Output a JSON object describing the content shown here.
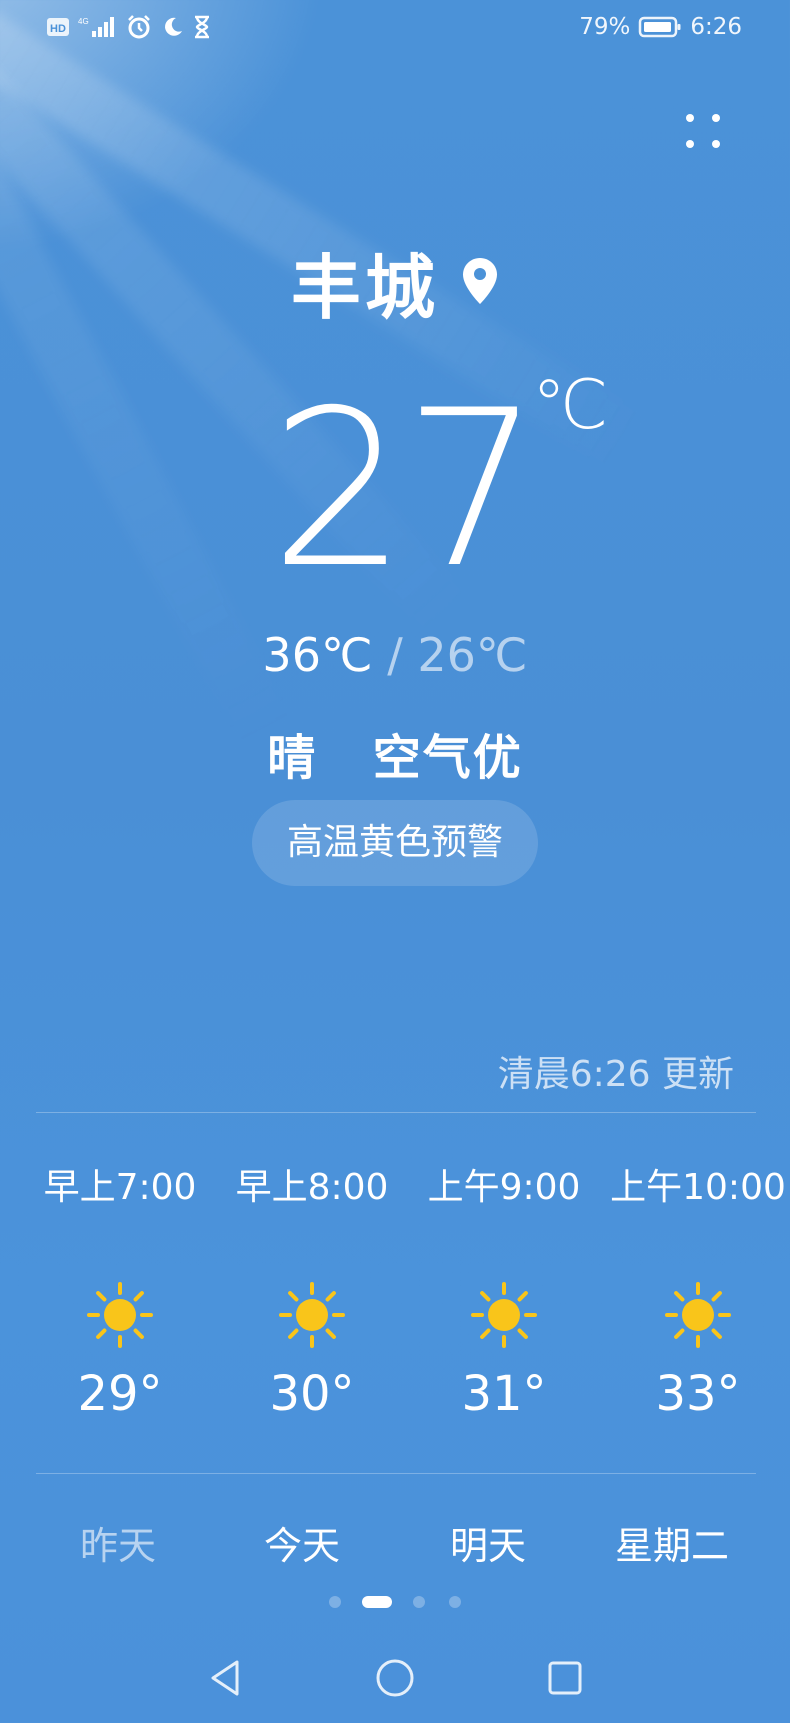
{
  "status_bar": {
    "battery_percent": "79%",
    "time": "6:26",
    "icons": [
      "hd-icon",
      "signal-4g-icon",
      "alarm-icon",
      "moon-icon",
      "hourglass-icon",
      "battery-icon"
    ]
  },
  "location": {
    "city": "丰城",
    "icon": "location-pin-icon"
  },
  "current": {
    "temperature": "27",
    "unit": "℃",
    "high": "36℃",
    "separator": "/",
    "low": "26℃",
    "condition": "晴",
    "air_quality": "空气优",
    "warning": "高温黄色预警",
    "updated": "清晨6:26 更新"
  },
  "hourly": [
    {
      "time": "早上7:00",
      "icon": "sun-icon",
      "temp": "29°"
    },
    {
      "time": "早上8:00",
      "icon": "sun-icon",
      "temp": "30°"
    },
    {
      "time": "上午9:00",
      "icon": "sun-icon",
      "temp": "31°"
    },
    {
      "time": "上午10:00",
      "icon": "sun-icon",
      "temp": "33°"
    }
  ],
  "day_tabs": [
    {
      "label": "昨天",
      "active": false
    },
    {
      "label": "今天",
      "active": true
    },
    {
      "label": "明天",
      "active": true
    },
    {
      "label": "星期二",
      "active": true
    }
  ],
  "pager": {
    "count": 4,
    "active_index": 1
  },
  "colors": {
    "sun": "#f9c51a",
    "background": "#4a8fd6"
  },
  "nav": [
    "back-icon",
    "home-icon",
    "recents-icon"
  ]
}
